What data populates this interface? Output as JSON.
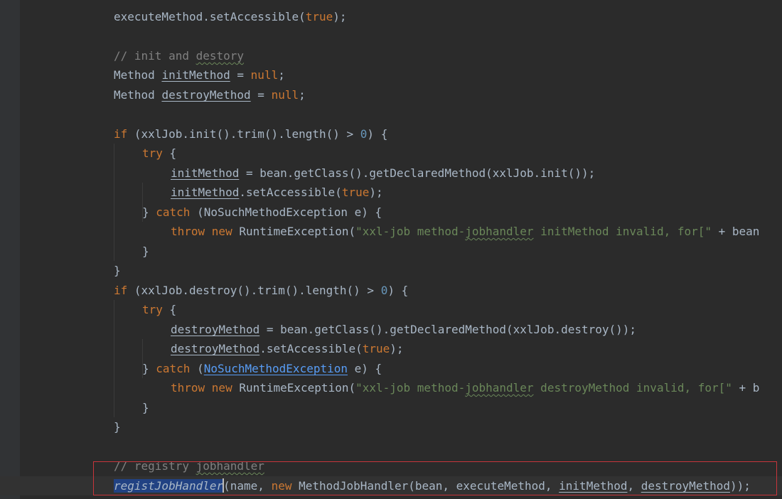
{
  "editor": {
    "language": "java",
    "theme_colors": {
      "background": "#2b2b2b",
      "keyword": "#cc7832",
      "number": "#6897bb",
      "string": "#6a8759",
      "comment": "#808080",
      "identifier": "#a9b7c6",
      "link": "#589df6",
      "highlight_border": "#c8353b"
    },
    "lines": [
      [
        [
          "t",
          "executeMethod.setAccessible("
        ],
        [
          "kw",
          "true"
        ],
        [
          "t",
          ");"
        ]
      ],
      [],
      [
        [
          "com",
          "// init and "
        ],
        [
          "com-typo",
          "destory"
        ]
      ],
      [
        [
          "t",
          "Method "
        ],
        [
          "fld",
          "initMethod"
        ],
        [
          "t",
          " = "
        ],
        [
          "kw",
          "null"
        ],
        [
          "t",
          ";"
        ]
      ],
      [
        [
          "t",
          "Method "
        ],
        [
          "fld",
          "destroyMethod"
        ],
        [
          "t",
          " = "
        ],
        [
          "kw",
          "null"
        ],
        [
          "t",
          ";"
        ]
      ],
      [],
      [
        [
          "kw",
          "if"
        ],
        [
          "t",
          " (xxlJob.init().trim().length() > "
        ],
        [
          "num",
          "0"
        ],
        [
          "t",
          ") {"
        ]
      ],
      [
        [
          "kw",
          "try"
        ],
        [
          "t",
          " {"
        ]
      ],
      [
        [
          "fld",
          "initMethod"
        ],
        [
          "t",
          " = bean.getClass().getDeclaredMethod(xxlJob.init());"
        ]
      ],
      [
        [
          "fld",
          "initMethod"
        ],
        [
          "t",
          ".setAccessible("
        ],
        [
          "kw",
          "true"
        ],
        [
          "t",
          ");"
        ]
      ],
      [
        [
          "t",
          "} "
        ],
        [
          "kw",
          "catch"
        ],
        [
          "t",
          " (NoSuchMethodException e) {"
        ]
      ],
      [
        [
          "kw",
          "throw new"
        ],
        [
          "t",
          " RuntimeException("
        ],
        [
          "str",
          "\"xxl-job method-"
        ],
        [
          "str-typo",
          "jobhandler"
        ],
        [
          "str",
          " initMethod invalid, for[\""
        ],
        [
          "t",
          " + bean"
        ]
      ],
      [
        [
          "t",
          "}"
        ]
      ],
      [
        [
          "t",
          "}"
        ]
      ],
      [
        [
          "kw",
          "if"
        ],
        [
          "t",
          " (xxlJob.destroy().trim().length() > "
        ],
        [
          "num",
          "0"
        ],
        [
          "t",
          ") {"
        ]
      ],
      [
        [
          "kw",
          "try"
        ],
        [
          "t",
          " {"
        ]
      ],
      [
        [
          "fld",
          "destroyMethod"
        ],
        [
          "t",
          " = bean.getClass().getDeclaredMethod(xxlJob.destroy());"
        ]
      ],
      [
        [
          "fld",
          "destroyMethod"
        ],
        [
          "t",
          ".setAccessible("
        ],
        [
          "kw",
          "true"
        ],
        [
          "t",
          ");"
        ]
      ],
      [
        [
          "t",
          "} "
        ],
        [
          "kw",
          "catch"
        ],
        [
          "t",
          " ("
        ],
        [
          "link",
          "NoSuchMethodException"
        ],
        [
          "t",
          " e) {"
        ]
      ],
      [
        [
          "kw",
          "throw new"
        ],
        [
          "t",
          " RuntimeException("
        ],
        [
          "str",
          "\"xxl-job method-"
        ],
        [
          "str-typo",
          "jobhandler"
        ],
        [
          "str",
          " destroyMethod invalid, for[\""
        ],
        [
          "t",
          " + b"
        ]
      ],
      [
        [
          "t",
          "}"
        ]
      ],
      [
        [
          "t",
          "}"
        ]
      ],
      [],
      [
        [
          "com",
          "// registry "
        ],
        [
          "com-typo",
          "jobhandler"
        ]
      ],
      [
        [
          "call",
          "registJobHandler"
        ],
        [
          "caret",
          ""
        ],
        [
          "t",
          "(name, "
        ],
        [
          "kw",
          "new"
        ],
        [
          "t",
          " MethodJobHandler(bean, executeMethod, "
        ],
        [
          "fld",
          "initMethod"
        ],
        [
          "t",
          ", "
        ],
        [
          "fld",
          "destroyMethod"
        ],
        [
          "t",
          "));"
        ]
      ]
    ]
  }
}
